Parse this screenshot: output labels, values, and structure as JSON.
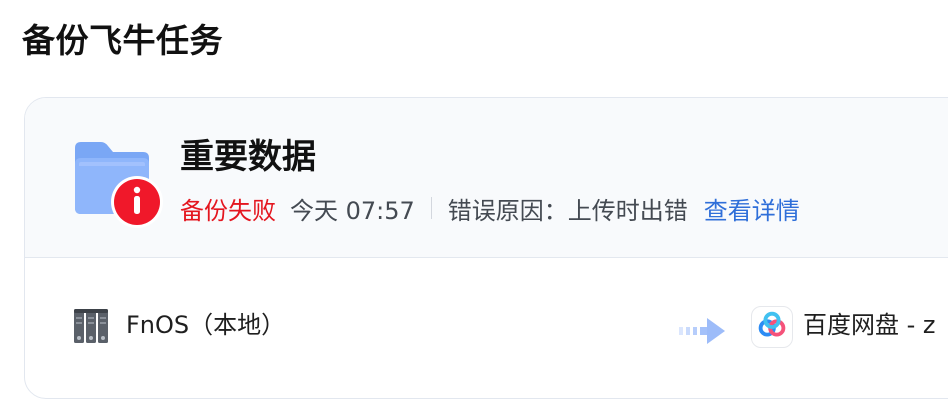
{
  "page": {
    "title": "备份飞牛任务"
  },
  "task": {
    "name": "重要数据",
    "status": "备份失败",
    "time": "今天 07:57",
    "error_label": "错误原因：",
    "error_reason": "上传时出错",
    "details_link": "查看详情",
    "source": "FnOS（本地）",
    "target": "百度网盘 - z"
  },
  "icons": {
    "folder": "folder-icon",
    "error_badge": "error-badge-icon",
    "nas": "nas-server-icon",
    "arrow": "arrow-right-icon",
    "baidu": "baidu-netdisk-icon"
  },
  "colors": {
    "error": "#e4161f",
    "link": "#2f6fd9",
    "folder": "#7aa7f5",
    "card_header_bg": "#f8fafc",
    "card_border": "#e2e7ef"
  }
}
